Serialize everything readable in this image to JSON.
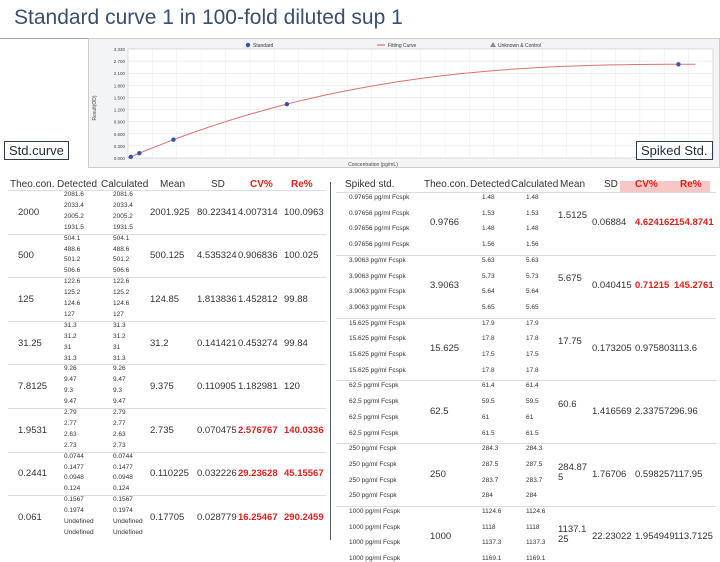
{
  "title": "Standard curve 1 in 100-fold diluted sup 1",
  "callouts": {
    "std": "Std.curve",
    "spiked": "Spiked Std."
  },
  "colors": {
    "accent_red": "#e0201b",
    "title_blue": "#3a4f6d",
    "fit_line": "#e07070",
    "std_point": "#3355aa"
  },
  "chart_data": {
    "type": "scatter",
    "legend": [
      "Standard",
      "Fitting Curve",
      "Unknown & Control"
    ],
    "legend_position": "top-center",
    "ylabel": "Result(OD)",
    "xlabel": "Concentration (pg/mL)",
    "ytick_labels": [
      "3.330",
      "2.700",
      "2.100",
      "1.800",
      "1.500",
      "1.200",
      "0.900",
      "0.600",
      "0.300",
      "0.000"
    ],
    "ylim": [
      0,
      3.33
    ],
    "grid": true
  },
  "left_table": {
    "headers": [
      "Theo.con.",
      "Detected",
      "Calculated",
      "Mean",
      "SD",
      "CV%",
      "Re%"
    ],
    "groups": [
      {
        "theo": "2000",
        "rows": [
          [
            "2081.6",
            "2081.6"
          ],
          [
            "2033.4",
            "2033.4"
          ],
          [
            "2005.2",
            "2005.2"
          ],
          [
            "1931.5",
            "1931.5"
          ]
        ],
        "mean": "2001.925",
        "sd": "80.22341",
        "cv": "4.007314",
        "re": "100.0963",
        "red": false
      },
      {
        "theo": "500",
        "rows": [
          [
            "504.1",
            "504.1"
          ],
          [
            "488.6",
            "488.6"
          ],
          [
            "501.2",
            "501.2"
          ],
          [
            "506.6",
            "506.6"
          ]
        ],
        "mean": "500.125",
        "sd": "4.535324",
        "cv": "0.906836",
        "re": "100.025",
        "red": false
      },
      {
        "theo": "125",
        "rows": [
          [
            "122.6",
            "122.6"
          ],
          [
            "125.2",
            "125.2"
          ],
          [
            "124.6",
            "124.6"
          ],
          [
            "127",
            "127"
          ]
        ],
        "mean": "124.85",
        "sd": "1.813836",
        "cv": "1.452812",
        "re": "99.88",
        "red": false
      },
      {
        "theo": "31.25",
        "rows": [
          [
            "31.3",
            "31.3"
          ],
          [
            "31.2",
            "31.2"
          ],
          [
            "31",
            "31"
          ],
          [
            "31.3",
            "31.3"
          ]
        ],
        "mean": "31.2",
        "sd": "0.141421",
        "cv": "0.453274",
        "re": "99.84",
        "red": false
      },
      {
        "theo": "7.8125",
        "rows": [
          [
            "9.26",
            "9.26"
          ],
          [
            "9.47",
            "9.47"
          ],
          [
            "9.3",
            "9.3"
          ],
          [
            "9.47",
            "9.47"
          ]
        ],
        "mean": "9.375",
        "sd": "0.110905",
        "cv": "1.182981",
        "re": "120",
        "red": false
      },
      {
        "theo": "1.9531",
        "rows": [
          [
            "2.79",
            "2.79"
          ],
          [
            "2.77",
            "2.77"
          ],
          [
            "2.63",
            "2.63"
          ],
          [
            "2.73",
            "2.73"
          ]
        ],
        "mean": "2.735",
        "sd": "0.070475",
        "cv": "2.576767",
        "re": "140.0336",
        "red": true
      },
      {
        "theo": "0.2441",
        "rows": [
          [
            "0.0744",
            "0.0744"
          ],
          [
            "0.1477",
            "0.1477"
          ],
          [
            "0.0948",
            "0.0948"
          ],
          [
            "0.124",
            "0.124"
          ]
        ],
        "mean": "0.110225",
        "sd": "0.032226",
        "cv": "29.23628",
        "re": "45.15567",
        "red": true
      },
      {
        "theo": "0.061",
        "rows": [
          [
            "0.1567",
            "0.1567"
          ],
          [
            "0.1974",
            "0.1974"
          ],
          [
            "Undefined",
            "Undefined"
          ],
          [
            "Undefined",
            "Undefined"
          ]
        ],
        "mean": "0.17705",
        "sd": "0.028779",
        "cv": "16.25467",
        "re": "290.2459",
        "red": true
      }
    ]
  },
  "right_table": {
    "headers": [
      "Spiked std.",
      "Theo.con.",
      "Detected",
      "Calculated",
      "Mean",
      "SD",
      "CV%",
      "Re%"
    ],
    "groups": [
      {
        "theo": "0.9766",
        "rows": [
          [
            "0.97656 pg/ml Fcspk",
            "1.48",
            "1.48"
          ],
          [
            "0.97656 pg/ml Fcspk",
            "1.53",
            "1.53"
          ],
          [
            "0.97656 pg/ml Fcspk",
            "1.48",
            "1.48"
          ],
          [
            "0.97656 pg/ml Fcspk",
            "1.56",
            "1.56"
          ]
        ],
        "mean": "1.5125",
        "sd": "0.06884",
        "cv": "4.624162",
        "re": "154.8741",
        "red": true
      },
      {
        "theo": "3.9063",
        "rows": [
          [
            "3.9063 pg/ml Fcspk",
            "5.63",
            "5.63"
          ],
          [
            "3.9063 pg/ml Fcspk",
            "5.73",
            "5.73"
          ],
          [
            "3.9063 pg/ml Fcspk",
            "5.64",
            "5.64"
          ],
          [
            "3.9063 pg/ml Fcspk",
            "5.65",
            "5.65"
          ]
        ],
        "mean": "5.675",
        "sd": "0.040415",
        "cv": "0.71215",
        "re": "145.2761",
        "red": true
      },
      {
        "theo": "15.625",
        "rows": [
          [
            "15.625 pg/ml Fcspk",
            "17.9",
            "17.9"
          ],
          [
            "15.625 pg/ml Fcspk",
            "17.8",
            "17.8"
          ],
          [
            "15.625 pg/ml Fcspk",
            "17.5",
            "17.5"
          ],
          [
            "15.625 pg/ml Fcspk",
            "17.8",
            "17.8"
          ]
        ],
        "mean": "17.75",
        "sd": "0.173205",
        "cv": "0.975803",
        "re": "113.6",
        "red": false
      },
      {
        "theo": "62.5",
        "rows": [
          [
            "62.5 pg/ml Fcspk",
            "61.4",
            "61.4"
          ],
          [
            "62.5 pg/ml Fcspk",
            "59.5",
            "59.5"
          ],
          [
            "62.5 pg/ml Fcspk",
            "61",
            "61"
          ],
          [
            "62.5 pg/ml Fcspk",
            "61.5",
            "61.5"
          ]
        ],
        "mean": "60.6",
        "sd": "1.416569",
        "cv": "2.337572",
        "re": "96.96",
        "red": false
      },
      {
        "theo": "250",
        "rows": [
          [
            "250 pg/ml Fcspk",
            "284.3",
            "284.3"
          ],
          [
            "250 pg/ml Fcspk",
            "287.5",
            "287.5"
          ],
          [
            "250 pg/ml Fcspk",
            "283.7",
            "283.7"
          ],
          [
            "250 pg/ml Fcspk",
            "284",
            "284"
          ]
        ],
        "mean": "284.87\n5",
        "sd": "1.76706",
        "cv": "0.598257",
        "re": "117.95",
        "red": false
      },
      {
        "theo": "1000",
        "rows": [
          [
            "1000 pg/ml Fcspk",
            "1124.6",
            "1124.6"
          ],
          [
            "1000 pg/ml Fcspk",
            "1118",
            "1118"
          ],
          [
            "1000 pg/ml Fcspk",
            "1137.3",
            "1137.3"
          ],
          [
            "1000 pg/ml Fcspk",
            "1169.1",
            "1169.1"
          ]
        ],
        "mean": "1137.1\n25",
        "sd": "22.23022",
        "cv": "1.954949",
        "re": "113.7125",
        "red": false
      }
    ]
  }
}
